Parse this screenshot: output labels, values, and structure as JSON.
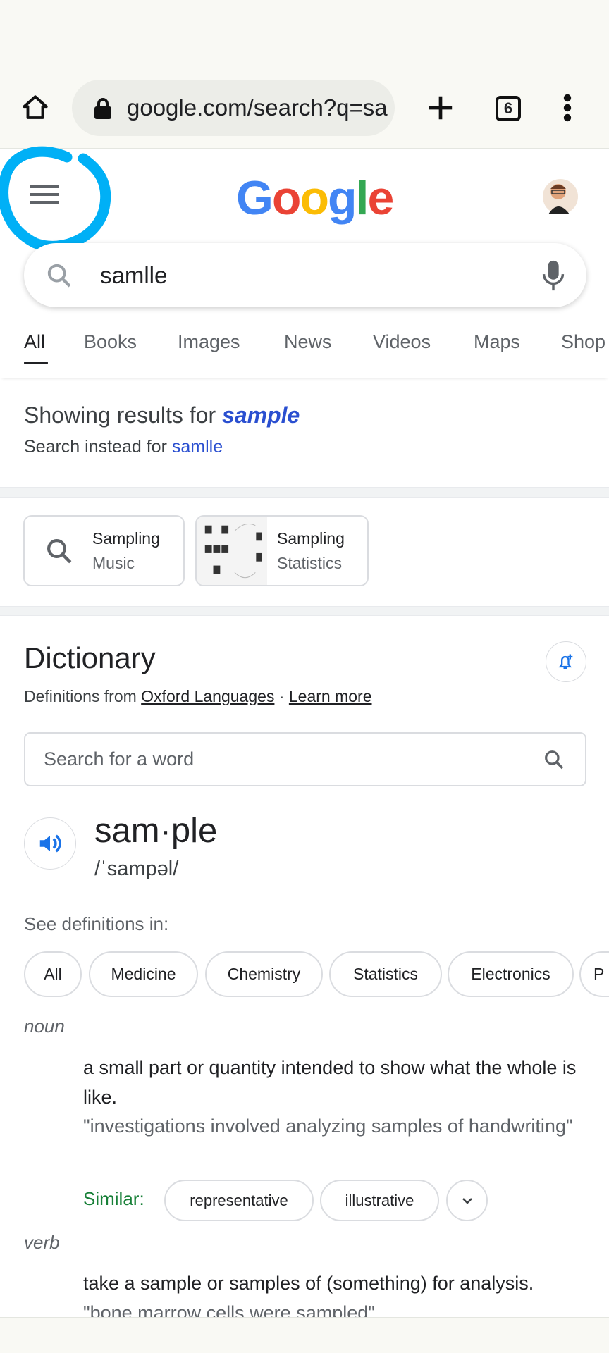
{
  "browser": {
    "url": "google.com/search?q=sa",
    "tab_count": "6",
    "icons": [
      "home-icon",
      "lock-icon",
      "plus-icon",
      "tabs-icon",
      "more-vert-icon"
    ]
  },
  "header": {
    "logo": "Google",
    "icons": [
      "menu-icon",
      "avatar"
    ],
    "annotation_color": "#00b0f6"
  },
  "search": {
    "value": "samlle",
    "icons": [
      "search-icon",
      "mic-icon"
    ]
  },
  "tabs": [
    {
      "label": "All",
      "active": true
    },
    {
      "label": "Books"
    },
    {
      "label": "Images"
    },
    {
      "label": "News"
    },
    {
      "label": "Videos"
    },
    {
      "label": "Maps"
    },
    {
      "label": "Shop"
    }
  ],
  "correction": {
    "showing_prefix": "Showing results for",
    "corrected": "sample",
    "instead_prefix": "Search instead for",
    "original": "samlle"
  },
  "related": [
    {
      "title": "Sampling",
      "subtitle": "Music"
    },
    {
      "title": "Sampling",
      "subtitle": "Statistics"
    }
  ],
  "dictionary": {
    "title": "Dictionary",
    "source_prefix": "Definitions from",
    "source": "Oxford Languages",
    "separator": "·",
    "learn_more": "Learn more",
    "word_search_placeholder": "Search for a word",
    "word": "sam·ple",
    "pronunciation": "/ˈsampəl/",
    "see_in": "See definitions in:",
    "fields": [
      "All",
      "Medicine",
      "Chemistry",
      "Statistics",
      "Electronics",
      "P"
    ],
    "noun": {
      "pos": "noun",
      "definition": "a small part or quantity intended to show what the whole is like.",
      "example": "\"investigations involved analyzing samples of handwriting\"",
      "similar_label": "Similar:",
      "similar": [
        "representative",
        "illustrative"
      ]
    },
    "verb": {
      "pos": "verb",
      "definition": "take a sample or samples of (something) for analysis.",
      "example": "\"bone marrow cells were sampled\""
    }
  },
  "colors": {
    "link": "#1a0dab",
    "blue": "#1a73e8",
    "green": "#188038"
  }
}
